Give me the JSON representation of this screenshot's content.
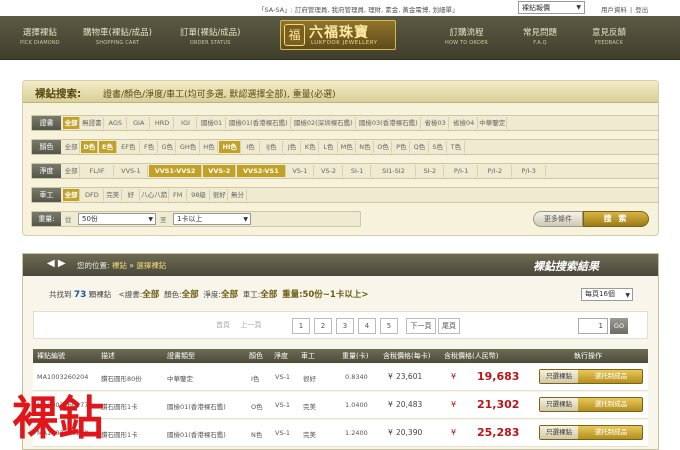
{
  "top": {
    "notice": "「SA-SA」: 訂府管理員, 我府管理員, 理財, 素金, 黃金電博, 划細單」",
    "language": "裸鉆報價",
    "links": [
      "用戶資料",
      "登出"
    ]
  },
  "nav": [
    {
      "cn": "選擇裸鉆",
      "en": "PICK DIAMOND"
    },
    {
      "cn": "購物車(裸鉆/成品)",
      "en": "SHOPPING CART"
    },
    {
      "cn": "訂單(裸鉆/成品)",
      "en": "ORDER STATUS"
    },
    {
      "cn": "訂購流程",
      "en": "HOW TO ORDER"
    },
    {
      "cn": "常見問題",
      "en": "F.A.Q"
    },
    {
      "cn": "意見反饋",
      "en": "FEEDBACK"
    }
  ],
  "logo": {
    "mark": "福",
    "cn": "六福珠寶",
    "en": "LUKFOOK JEWELLERY"
  },
  "search": {
    "title": "裸鉆搜索:",
    "subtitle": "證書/顏色/淨度/車工(均可多選, 默認選擇全部), 重量(必選)",
    "rows": [
      {
        "label": "證書",
        "options": [
          "全部",
          "無證書",
          "AGS",
          "GIA",
          "HRD",
          "IGI",
          "國檢01",
          "國檢01(香港裸石鑑)",
          "國檢02(深圳裸石鑑)",
          "國檢03(香港裸石鑑)",
          "省檢03",
          "省檢04",
          "中華鑒定"
        ],
        "selected": [
          0
        ]
      },
      {
        "label": "顏色",
        "options": [
          "全部",
          "D色",
          "E色",
          "EF色",
          "F色",
          "G色",
          "GH色",
          "H色",
          "HI色",
          "I色",
          "IJ色",
          "J色",
          "K色",
          "L色",
          "M色",
          "N色",
          "O色",
          "P色",
          "Q色",
          "S色",
          "T色"
        ],
        "selected": [
          1,
          2,
          8
        ]
      },
      {
        "label": "淨度",
        "options": [
          "全部",
          "FL/IF",
          "VVS-1",
          "VVS1-VVS2",
          "VVS-2",
          "VVS2-VS1",
          "VS-1",
          "VS-2",
          "SI-1",
          "SI1-SI2",
          "SI-2",
          "P/I-1",
          "P/I-2",
          "P/I-3"
        ],
        "selected": [
          3,
          4,
          5
        ]
      },
      {
        "label": "車工",
        "options": [
          "全部",
          "DFD",
          "完美",
          "好",
          "八心八箭",
          "FM",
          "98級",
          "很好",
          "無分"
        ],
        "selected": [
          0
        ]
      }
    ],
    "weight": {
      "label": "重量:",
      "from_label": "從",
      "from_value": "50份",
      "to_label": "至",
      "to_value": "1卡以上"
    },
    "advanced_label": "更多條件",
    "search_label": "搜 索"
  },
  "results": {
    "breadcrumb": {
      "prefix": "您的位置:",
      "a": "裸鉆",
      "sep": "»",
      "b": "選擇裸鉆"
    },
    "title": "裸鉆搜索結果",
    "summary": {
      "found_prefix": "共找到",
      "count": "73",
      "found_suffix": "顆裸鉆",
      "cert_label": "<證書:",
      "cert_value": "全部",
      "color_label": "顏色:",
      "color_value": "全部",
      "clarity_label": "淨度:",
      "clarity_value": "全部",
      "cut_label": "車工:",
      "cut_value": "全部",
      "weight_value": "重量:50份~1卡以上>"
    },
    "per_page": "每頁16個",
    "pager": {
      "first": "首頁",
      "prev": "上一頁",
      "pages": [
        "1",
        "2",
        "3",
        "4",
        "5"
      ],
      "next": "下一頁",
      "last": "尾頁",
      "page_input": "1",
      "go": "GO"
    },
    "columns": [
      "裸鉆編號",
      "描述",
      "證書類型",
      "顏色",
      "淨度",
      "車工",
      "重量(卡)",
      "含稅價格(每卡)",
      "含稅價格(人民幣)",
      "執行操作"
    ],
    "rows": [
      {
        "id": "MA1003260204",
        "desc": "鑽石圓形80份",
        "cert": "中華鑒定",
        "color": "I色",
        "clarity": "VS-1",
        "cut": "很好",
        "weight": "0.8340",
        "card_cur": "¥",
        "card_price": "23,601",
        "rmb_cur": "¥",
        "price": "19,683"
      },
      {
        "id": "MA1003260277",
        "desc": "鑽石圓形1卡",
        "cert": "國檢01(香港裸石鑑)",
        "color": "O色",
        "clarity": "VS-1",
        "cut": "完美",
        "weight": "1.0400",
        "card_cur": "¥",
        "card_price": "20,483",
        "rmb_cur": "¥",
        "price": "21,302"
      },
      {
        "id": "MA1003260278",
        "desc": "鑽石圓形1卡",
        "cert": "國檢01(香港裸石鑑)",
        "color": "N色",
        "clarity": "VS-1",
        "cut": "完美",
        "weight": "1.2400",
        "card_cur": "¥",
        "card_price": "20,390",
        "rmb_cur": "¥",
        "price": "25,283"
      }
    ],
    "row_btn_a": "只選裸鉆",
    "row_btn_b": "選托制成品"
  },
  "overlay_text": "裸鉆"
}
